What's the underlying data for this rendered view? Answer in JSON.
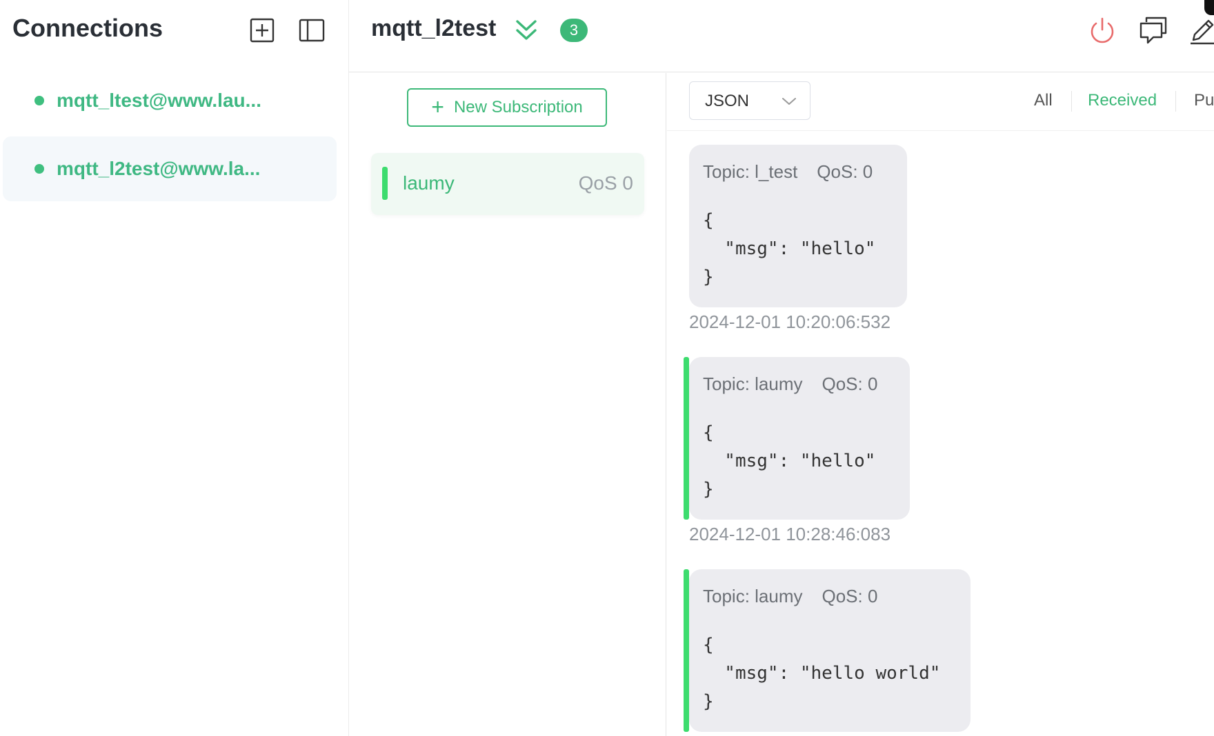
{
  "sidebar": {
    "title": "Connections",
    "connections": [
      {
        "label": "mqtt_ltest@www.lau...",
        "status": "connected"
      },
      {
        "label": "mqtt_l2test@www.la...",
        "status": "connected",
        "active": true
      }
    ]
  },
  "header": {
    "title": "mqtt_l2test",
    "badge_count": "3"
  },
  "subscriptions": {
    "new_button_label": "New Subscription",
    "items": [
      {
        "topic": "laumy",
        "qos": "QoS 0",
        "color": "#3ddc6e"
      }
    ]
  },
  "messages": {
    "format": "JSON",
    "filters": [
      "All",
      "Received",
      "Pu"
    ],
    "active_filter": "Received",
    "items": [
      {
        "topic": "Topic: l_test",
        "qos": "QoS: 0",
        "payload": "{\n  \"msg\": \"hello\"\n}",
        "time": "2024-12-01 10:20:06:532"
      },
      {
        "topic": "Topic: laumy",
        "qos": "QoS: 0",
        "payload": "{\n  \"msg\": \"hello\"\n}",
        "time": "2024-12-01 10:28:46:083"
      },
      {
        "topic": "Topic: laumy",
        "qos": "QoS: 0",
        "payload": "{\n  \"msg\": \"hello world\"\n}"
      }
    ]
  },
  "colors": {
    "accent": "#3cb878",
    "disconnect": "#e86a6a"
  }
}
